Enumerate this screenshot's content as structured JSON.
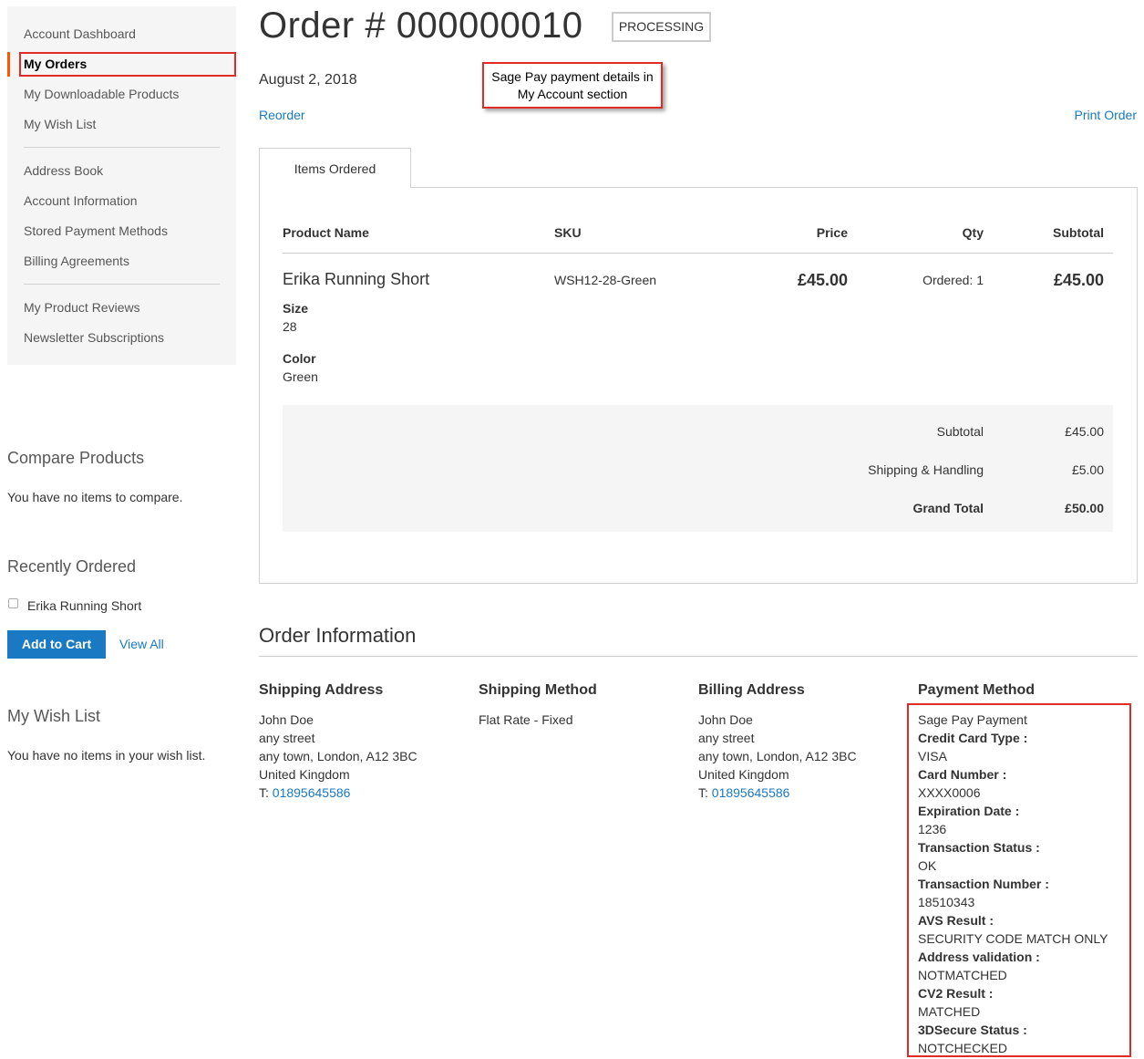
{
  "sidebar": {
    "nav": [
      {
        "label": "Account Dashboard"
      },
      {
        "label": "My Orders"
      },
      {
        "label": "My Downloadable Products"
      },
      {
        "label": "My Wish List"
      },
      {
        "label": "Address Book"
      },
      {
        "label": "Account Information"
      },
      {
        "label": "Stored Payment Methods"
      },
      {
        "label": "Billing Agreements"
      },
      {
        "label": "My Product Reviews"
      },
      {
        "label": "Newsletter Subscriptions"
      }
    ],
    "compare": {
      "title": "Compare Products",
      "empty_text": "You have no items to compare."
    },
    "recently_ordered": {
      "title": "Recently Ordered",
      "item_label": "Erika Running Short",
      "add_to_cart_label": "Add to Cart",
      "view_all_label": "View All"
    },
    "wishlist": {
      "title": "My Wish List",
      "empty_text": "You have no items in your wish list."
    }
  },
  "order": {
    "title": "Order # 000000010",
    "status": "PROCESSING",
    "date": "August 2, 2018",
    "reorder_label": "Reorder",
    "print_label": "Print Order",
    "callout": {
      "line1": "Sage Pay payment details in",
      "line2": "My Account section"
    },
    "tab_label": "Items Ordered",
    "table": {
      "headers": {
        "product": "Product Name",
        "sku": "SKU",
        "price": "Price",
        "qty": "Qty",
        "subtotal": "Subtotal"
      },
      "item": {
        "name": "Erika Running Short",
        "sku": "WSH12-28-Green",
        "price": "£45.00",
        "qty": "Ordered: 1",
        "subtotal": "£45.00",
        "options": [
          {
            "label": "Size",
            "value": "28"
          },
          {
            "label": "Color",
            "value": "Green"
          }
        ]
      }
    },
    "totals": {
      "subtotal_label": "Subtotal",
      "subtotal_value": "£45.00",
      "shipping_label": "Shipping & Handling",
      "shipping_value": "£5.00",
      "grand_label": "Grand Total",
      "grand_value": "£50.00"
    }
  },
  "info": {
    "title": "Order Information",
    "shipping_address": {
      "title": "Shipping Address",
      "name": "John Doe",
      "street": "any street",
      "city": "any town, London, A12 3BC",
      "country": "United Kingdom",
      "phone_prefix": "T: ",
      "phone": "01895645586"
    },
    "shipping_method": {
      "title": "Shipping Method",
      "value": "Flat Rate - Fixed"
    },
    "billing_address": {
      "title": "Billing Address",
      "name": "John Doe",
      "street": "any street",
      "city": "any town, London, A12 3BC",
      "country": "United Kingdom",
      "phone_prefix": "T: ",
      "phone": "01895645586"
    },
    "payment": {
      "title": "Payment Method",
      "method": "Sage Pay Payment",
      "fields": [
        {
          "label": "Credit Card Type :",
          "value": "VISA"
        },
        {
          "label": "Card Number :",
          "value": "XXXX0006"
        },
        {
          "label": "Expiration Date :",
          "value": "1236"
        },
        {
          "label": "Transaction Status :",
          "value": "OK"
        },
        {
          "label": "Transaction Number :",
          "value": "18510343"
        },
        {
          "label": "AVS Result :",
          "value": "SECURITY CODE MATCH ONLY"
        },
        {
          "label": "Address validation :",
          "value": "NOTMATCHED"
        },
        {
          "label": "CV2 Result :",
          "value": "MATCHED"
        },
        {
          "label": "3DSecure Status :",
          "value": "NOTCHECKED"
        }
      ]
    }
  }
}
